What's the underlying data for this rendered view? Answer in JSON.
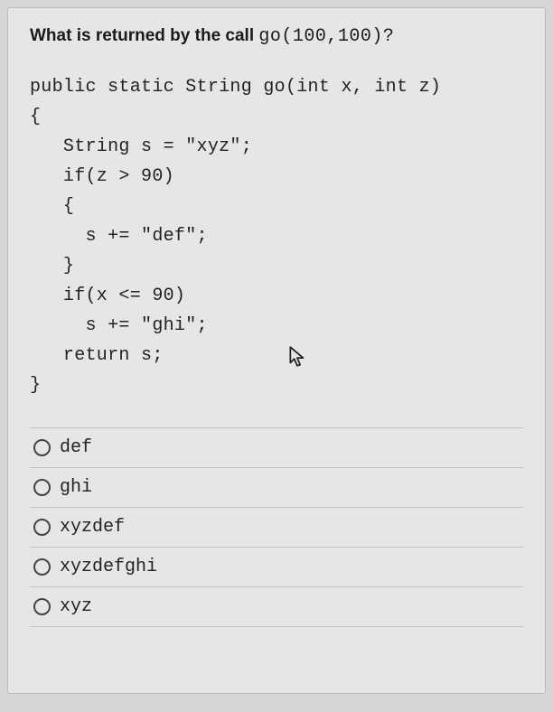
{
  "question": {
    "prefix": "What is returned by the call ",
    "call_code": "go(100,100)",
    "suffix": "?"
  },
  "code": "public static String go(int x, int z)\n{\n   String s = \"xyz\";\n   if(z > 90)\n   {\n     s += \"def\";\n   }\n   if(x <= 90)\n     s += \"ghi\";\n   return s;\n}",
  "options": [
    {
      "label": "def"
    },
    {
      "label": "ghi"
    },
    {
      "label": "xyzdef"
    },
    {
      "label": "xyzdefghi"
    },
    {
      "label": "xyz"
    }
  ]
}
